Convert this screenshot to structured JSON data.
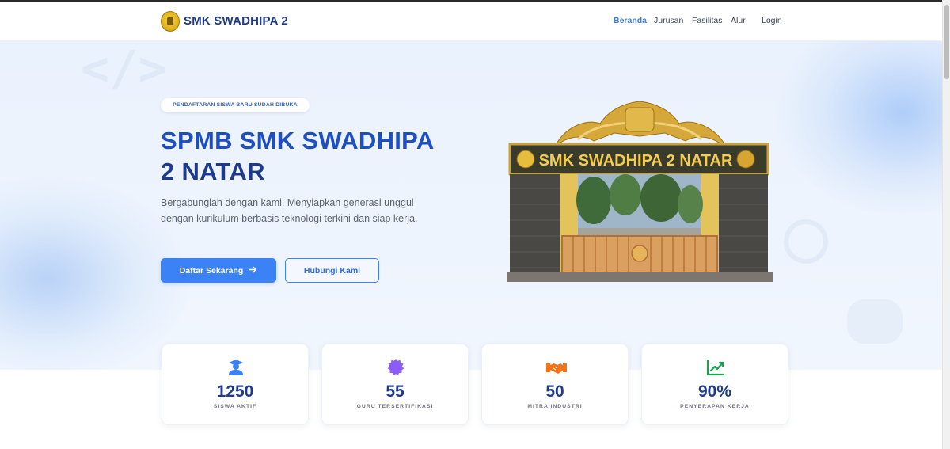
{
  "header": {
    "brand": "SMK SWADHIPA 2",
    "nav": [
      {
        "label": "Beranda",
        "active": true
      },
      {
        "label": "Jurusan",
        "active": false
      },
      {
        "label": "Fasilitas",
        "active": false
      },
      {
        "label": "Alur",
        "active": false
      },
      {
        "label": "Login",
        "active": false
      }
    ]
  },
  "hero": {
    "badge": "PENDAFTARAN SISWA BARU SUDAH DIBUKA",
    "title_line1": "SPMB SMK SWADHIPA",
    "title_line2": "2 NATAR",
    "description": "Bergabunglah dengan kami. Menyiapkan generasi unggul dengan kurikulum berbasis teknologi terkini dan siap kerja.",
    "primary_button": "Daftar Sekarang",
    "secondary_button": "Hubungi Kami",
    "gate_sign": "SMK SWADHIPA 2 NATAR"
  },
  "stats": [
    {
      "value": "1250",
      "label": "SISWA AKTIF",
      "icon": "graduate-icon",
      "color": "#3b82f6"
    },
    {
      "value": "55",
      "label": "GURU TERSERTIFIKASI",
      "icon": "certificate-icon",
      "color": "#8b5cf6"
    },
    {
      "value": "50",
      "label": "MITRA INDUSTRI",
      "icon": "handshake-icon",
      "color": "#f97316"
    },
    {
      "value": "90%",
      "label": "PENYERAPAN KERJA",
      "icon": "chart-line-icon",
      "color": "#16a34a"
    }
  ],
  "colors": {
    "primary": "#3b82f6",
    "brand_text": "#1e3a8a",
    "title": "#1e4fc2"
  }
}
